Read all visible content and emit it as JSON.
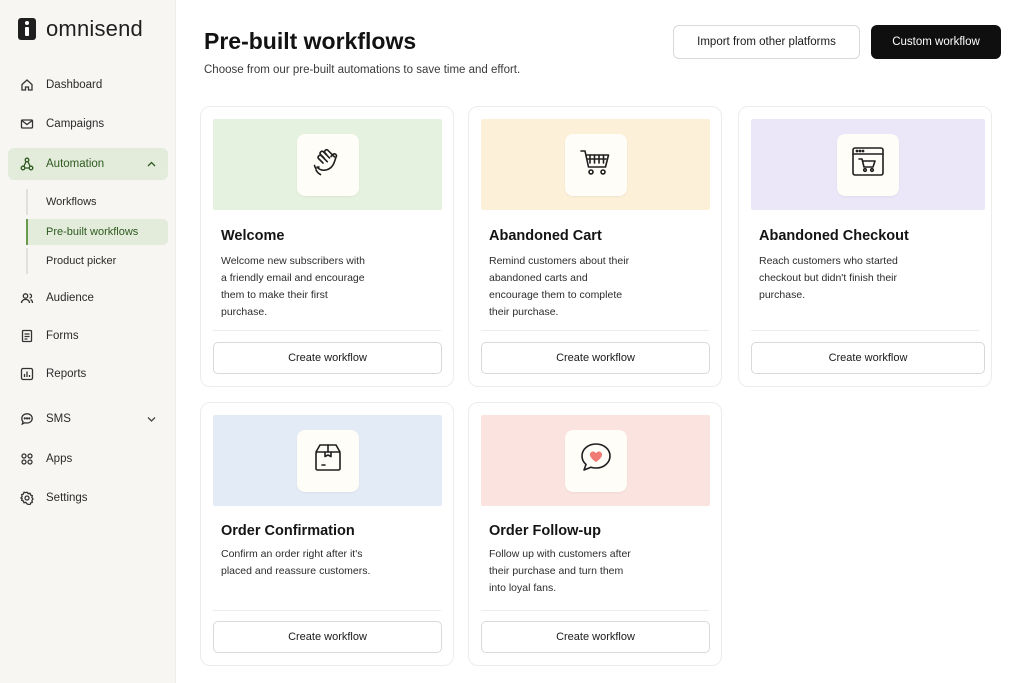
{
  "brand": {
    "name": "omnisend"
  },
  "sidebar": {
    "items": [
      {
        "label": "Dashboard",
        "icon": "home-icon"
      },
      {
        "label": "Campaigns",
        "icon": "mail-icon"
      },
      {
        "label": "Automation",
        "icon": "automation-icon",
        "expanded": true
      },
      {
        "label": "Audience",
        "icon": "users-icon"
      },
      {
        "label": "Forms",
        "icon": "form-icon"
      },
      {
        "label": "Reports",
        "icon": "chart-icon"
      },
      {
        "label": "SMS",
        "icon": "sms-icon",
        "expanded": false
      },
      {
        "label": "Apps",
        "icon": "apps-icon"
      },
      {
        "label": "Settings",
        "icon": "gear-icon"
      }
    ],
    "automation_sub": [
      {
        "label": "Workflows"
      },
      {
        "label": "Pre-built workflows",
        "active": true
      },
      {
        "label": "Product picker"
      }
    ]
  },
  "header": {
    "title": "Pre-built workflows",
    "subtitle": "Choose from our pre-built automations to save time and effort.",
    "import_label": "Import from other platforms",
    "custom_label": "Custom workflow"
  },
  "cards": [
    {
      "title": "Welcome",
      "desc": "Welcome new subscribers with a friendly email and encourage them to make their first purchase.",
      "button": "Create workflow",
      "banner_color": "#e5f2df",
      "icon": "wave-hand-icon"
    },
    {
      "title": "Abandoned Cart",
      "desc": "Remind customers about their abandoned carts and encourage them to complete their purchase.",
      "button": "Create workflow",
      "banner_color": "#fdf0d8",
      "icon": "shopping-cart-icon"
    },
    {
      "title": "Abandoned Checkout",
      "desc": "Reach customers who started checkout but didn't finish their purchase.",
      "button": "Create workflow",
      "banner_color": "#ebe6f8",
      "icon": "browser-cart-icon"
    },
    {
      "title": "Order Confirmation",
      "desc": "Confirm an order right after it's placed and reassure customers.",
      "button": "Create workflow",
      "banner_color": "#e3ecf6",
      "icon": "package-icon"
    },
    {
      "title": "Order Follow-up",
      "desc": "Follow up with customers after their purchase and turn them into loyal fans.",
      "button": "Create workflow",
      "banner_color": "#fbe3df",
      "icon": "heart-chat-icon"
    }
  ],
  "colors": {
    "active_nav": "#e3ebdb",
    "dark_button": "#0f0f0f"
  }
}
